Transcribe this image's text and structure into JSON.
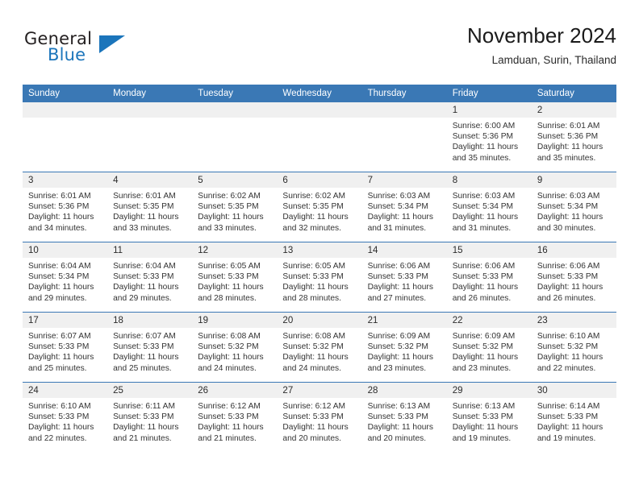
{
  "brand": {
    "word1": "General",
    "word2": "Blue",
    "logo_icon": "blue-triangle-icon",
    "accent_color": "#1b75bb"
  },
  "header": {
    "title": "November 2024",
    "subtitle": "Lamduan, Surin, Thailand"
  },
  "theme": {
    "header_bar_color": "#3a78b5",
    "daynum_band_color": "#f0f0f0",
    "text_color": "#333333"
  },
  "calendar": {
    "weekday_headers": [
      "Sunday",
      "Monday",
      "Tuesday",
      "Wednesday",
      "Thursday",
      "Friday",
      "Saturday"
    ],
    "labels": {
      "sunrise": "Sunrise:",
      "sunset": "Sunset:",
      "daylight": "Daylight:"
    },
    "weeks": [
      [
        {
          "day": "",
          "empty": true
        },
        {
          "day": "",
          "empty": true
        },
        {
          "day": "",
          "empty": true
        },
        {
          "day": "",
          "empty": true
        },
        {
          "day": "",
          "empty": true
        },
        {
          "day": "1",
          "sunrise": "Sunrise: 6:00 AM",
          "sunset": "Sunset: 5:36 PM",
          "daylight1": "Daylight: 11 hours",
          "daylight2": "and 35 minutes."
        },
        {
          "day": "2",
          "sunrise": "Sunrise: 6:01 AM",
          "sunset": "Sunset: 5:36 PM",
          "daylight1": "Daylight: 11 hours",
          "daylight2": "and 35 minutes."
        }
      ],
      [
        {
          "day": "3",
          "sunrise": "Sunrise: 6:01 AM",
          "sunset": "Sunset: 5:36 PM",
          "daylight1": "Daylight: 11 hours",
          "daylight2": "and 34 minutes."
        },
        {
          "day": "4",
          "sunrise": "Sunrise: 6:01 AM",
          "sunset": "Sunset: 5:35 PM",
          "daylight1": "Daylight: 11 hours",
          "daylight2": "and 33 minutes."
        },
        {
          "day": "5",
          "sunrise": "Sunrise: 6:02 AM",
          "sunset": "Sunset: 5:35 PM",
          "daylight1": "Daylight: 11 hours",
          "daylight2": "and 33 minutes."
        },
        {
          "day": "6",
          "sunrise": "Sunrise: 6:02 AM",
          "sunset": "Sunset: 5:35 PM",
          "daylight1": "Daylight: 11 hours",
          "daylight2": "and 32 minutes."
        },
        {
          "day": "7",
          "sunrise": "Sunrise: 6:03 AM",
          "sunset": "Sunset: 5:34 PM",
          "daylight1": "Daylight: 11 hours",
          "daylight2": "and 31 minutes."
        },
        {
          "day": "8",
          "sunrise": "Sunrise: 6:03 AM",
          "sunset": "Sunset: 5:34 PM",
          "daylight1": "Daylight: 11 hours",
          "daylight2": "and 31 minutes."
        },
        {
          "day": "9",
          "sunrise": "Sunrise: 6:03 AM",
          "sunset": "Sunset: 5:34 PM",
          "daylight1": "Daylight: 11 hours",
          "daylight2": "and 30 minutes."
        }
      ],
      [
        {
          "day": "10",
          "sunrise": "Sunrise: 6:04 AM",
          "sunset": "Sunset: 5:34 PM",
          "daylight1": "Daylight: 11 hours",
          "daylight2": "and 29 minutes."
        },
        {
          "day": "11",
          "sunrise": "Sunrise: 6:04 AM",
          "sunset": "Sunset: 5:33 PM",
          "daylight1": "Daylight: 11 hours",
          "daylight2": "and 29 minutes."
        },
        {
          "day": "12",
          "sunrise": "Sunrise: 6:05 AM",
          "sunset": "Sunset: 5:33 PM",
          "daylight1": "Daylight: 11 hours",
          "daylight2": "and 28 minutes."
        },
        {
          "day": "13",
          "sunrise": "Sunrise: 6:05 AM",
          "sunset": "Sunset: 5:33 PM",
          "daylight1": "Daylight: 11 hours",
          "daylight2": "and 28 minutes."
        },
        {
          "day": "14",
          "sunrise": "Sunrise: 6:06 AM",
          "sunset": "Sunset: 5:33 PM",
          "daylight1": "Daylight: 11 hours",
          "daylight2": "and 27 minutes."
        },
        {
          "day": "15",
          "sunrise": "Sunrise: 6:06 AM",
          "sunset": "Sunset: 5:33 PM",
          "daylight1": "Daylight: 11 hours",
          "daylight2": "and 26 minutes."
        },
        {
          "day": "16",
          "sunrise": "Sunrise: 6:06 AM",
          "sunset": "Sunset: 5:33 PM",
          "daylight1": "Daylight: 11 hours",
          "daylight2": "and 26 minutes."
        }
      ],
      [
        {
          "day": "17",
          "sunrise": "Sunrise: 6:07 AM",
          "sunset": "Sunset: 5:33 PM",
          "daylight1": "Daylight: 11 hours",
          "daylight2": "and 25 minutes."
        },
        {
          "day": "18",
          "sunrise": "Sunrise: 6:07 AM",
          "sunset": "Sunset: 5:33 PM",
          "daylight1": "Daylight: 11 hours",
          "daylight2": "and 25 minutes."
        },
        {
          "day": "19",
          "sunrise": "Sunrise: 6:08 AM",
          "sunset": "Sunset: 5:32 PM",
          "daylight1": "Daylight: 11 hours",
          "daylight2": "and 24 minutes."
        },
        {
          "day": "20",
          "sunrise": "Sunrise: 6:08 AM",
          "sunset": "Sunset: 5:32 PM",
          "daylight1": "Daylight: 11 hours",
          "daylight2": "and 24 minutes."
        },
        {
          "day": "21",
          "sunrise": "Sunrise: 6:09 AM",
          "sunset": "Sunset: 5:32 PM",
          "daylight1": "Daylight: 11 hours",
          "daylight2": "and 23 minutes."
        },
        {
          "day": "22",
          "sunrise": "Sunrise: 6:09 AM",
          "sunset": "Sunset: 5:32 PM",
          "daylight1": "Daylight: 11 hours",
          "daylight2": "and 23 minutes."
        },
        {
          "day": "23",
          "sunrise": "Sunrise: 6:10 AM",
          "sunset": "Sunset: 5:32 PM",
          "daylight1": "Daylight: 11 hours",
          "daylight2": "and 22 minutes."
        }
      ],
      [
        {
          "day": "24",
          "sunrise": "Sunrise: 6:10 AM",
          "sunset": "Sunset: 5:33 PM",
          "daylight1": "Daylight: 11 hours",
          "daylight2": "and 22 minutes."
        },
        {
          "day": "25",
          "sunrise": "Sunrise: 6:11 AM",
          "sunset": "Sunset: 5:33 PM",
          "daylight1": "Daylight: 11 hours",
          "daylight2": "and 21 minutes."
        },
        {
          "day": "26",
          "sunrise": "Sunrise: 6:12 AM",
          "sunset": "Sunset: 5:33 PM",
          "daylight1": "Daylight: 11 hours",
          "daylight2": "and 21 minutes."
        },
        {
          "day": "27",
          "sunrise": "Sunrise: 6:12 AM",
          "sunset": "Sunset: 5:33 PM",
          "daylight1": "Daylight: 11 hours",
          "daylight2": "and 20 minutes."
        },
        {
          "day": "28",
          "sunrise": "Sunrise: 6:13 AM",
          "sunset": "Sunset: 5:33 PM",
          "daylight1": "Daylight: 11 hours",
          "daylight2": "and 20 minutes."
        },
        {
          "day": "29",
          "sunrise": "Sunrise: 6:13 AM",
          "sunset": "Sunset: 5:33 PM",
          "daylight1": "Daylight: 11 hours",
          "daylight2": "and 19 minutes."
        },
        {
          "day": "30",
          "sunrise": "Sunrise: 6:14 AM",
          "sunset": "Sunset: 5:33 PM",
          "daylight1": "Daylight: 11 hours",
          "daylight2": "and 19 minutes."
        }
      ]
    ]
  }
}
